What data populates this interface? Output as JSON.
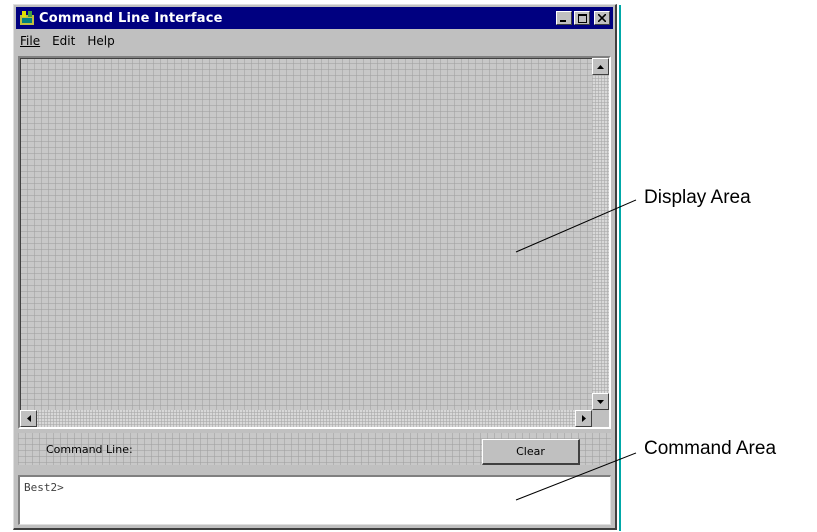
{
  "window": {
    "title": "Command Line Interface",
    "title_icon": "cli-app-icon",
    "controls": [
      "minimize-icon",
      "maximize-icon",
      "close-icon"
    ]
  },
  "menu": {
    "items": [
      {
        "label": "File",
        "mnemonic_index": 0
      },
      {
        "label": "Edit",
        "mnemonic_index": 0
      },
      {
        "label": "Help",
        "mnemonic_index": 0
      }
    ]
  },
  "command": {
    "label": "Command Line:",
    "clear_button": "Clear",
    "input_value": "Best2>"
  },
  "annotations": {
    "display_area": "Display Area",
    "command_area": "Command Area"
  },
  "colors": {
    "titlebar": "#000080",
    "window_face": "#c0c0c0",
    "input_bg": "#ffffff"
  }
}
